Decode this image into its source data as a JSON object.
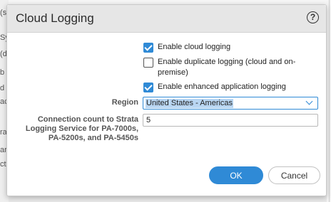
{
  "background": {
    "fragments": [
      "(s)",
      "Sys",
      "(d",
      "b",
      "d",
      "ac",
      "ra",
      "arc",
      "ctl"
    ]
  },
  "dialog": {
    "title": "Cloud Logging",
    "help_icon": "?",
    "checkboxes": [
      {
        "label": "Enable cloud logging",
        "checked": true
      },
      {
        "label": "Enable duplicate logging (cloud and on-premise)",
        "checked": false
      },
      {
        "label": "Enable enhanced application logging",
        "checked": true
      }
    ],
    "region": {
      "label": "Region",
      "value": "United States - Americas"
    },
    "connection_count": {
      "label": "Connection count to Strata Logging Service for PA-7000s, PA-5200s, and PA-5450s",
      "value": "5"
    },
    "buttons": {
      "ok": "OK",
      "cancel": "Cancel"
    }
  },
  "colors": {
    "accent": "#2f8ad6",
    "header_bg": "#e6e6e6",
    "selection_bg": "#b9d6f2"
  }
}
